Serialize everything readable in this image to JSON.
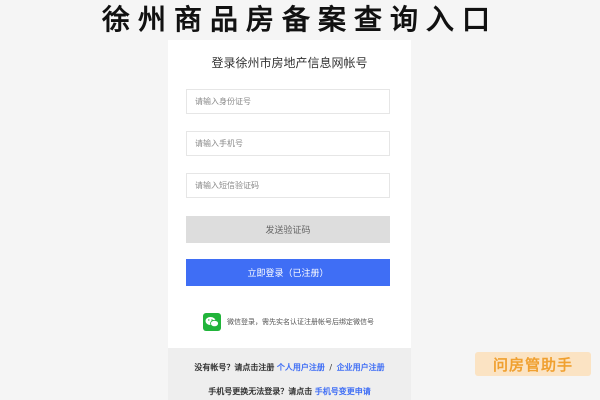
{
  "banner": {
    "title": "徐州商品房备案查询入口"
  },
  "card": {
    "title": "登录徐州市房地产信息网帐号",
    "id_placeholder": "请输入身份证号",
    "phone_placeholder": "请输入手机号",
    "sms_placeholder": "请输入短信验证码",
    "send_code_label": "发送验证码",
    "login_label": "立即登录（已注册）",
    "wechat_text": "微信登录，需先实名认证注册帐号后绑定微信号"
  },
  "footer": {
    "no_account_text": "没有帐号？请点击注册",
    "personal_register": "个人用户注册",
    "separator": "/",
    "enterprise_register": "企业用户注册",
    "phone_change_text": "手机号更换无法登录？请点击",
    "phone_change_link": "手机号变更申请"
  },
  "watermark": {
    "text": "问房管助手"
  },
  "colors": {
    "primary": "#3f6ef5",
    "wechat": "#21b43a",
    "watermark_bg": "#fbe3c3",
    "watermark_text": "#f0a030"
  }
}
